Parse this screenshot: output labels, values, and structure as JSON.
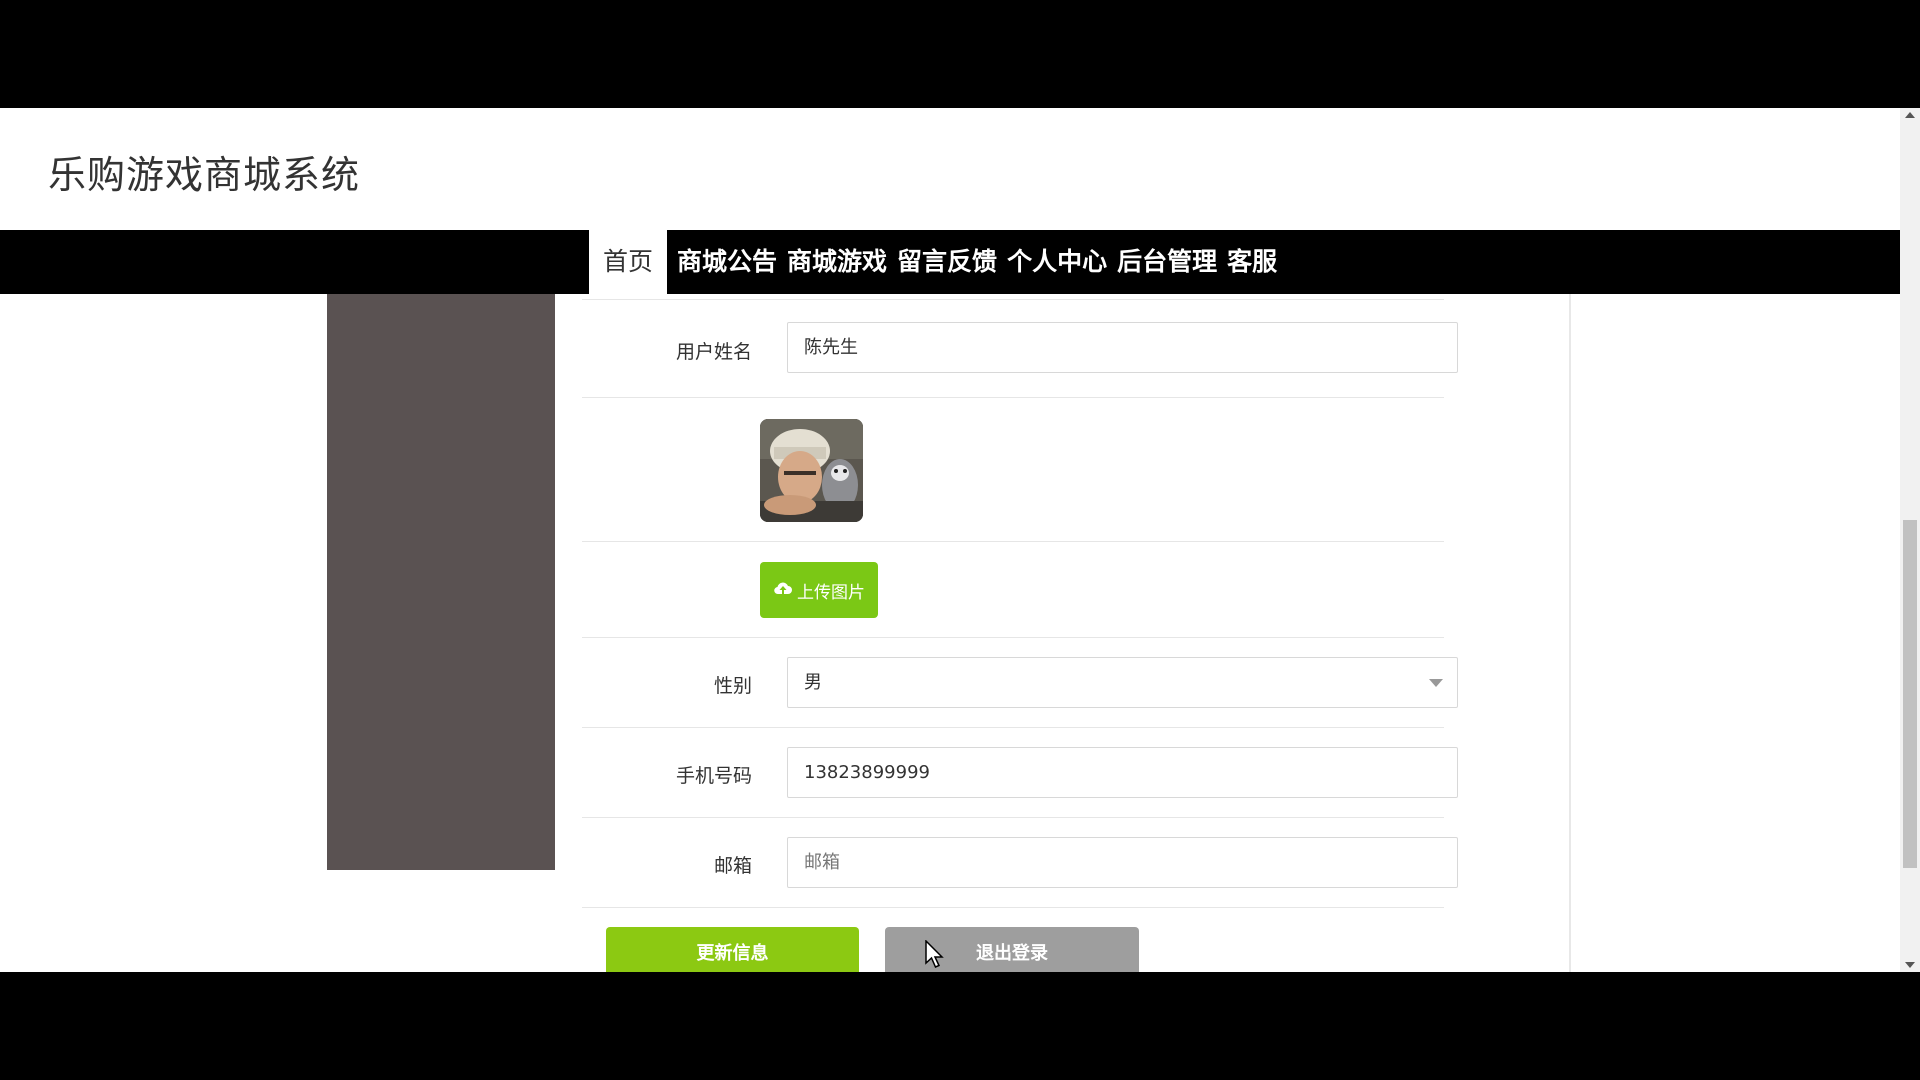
{
  "site": {
    "title": "乐购游戏商城系统"
  },
  "nav": {
    "items": [
      {
        "label": "首页",
        "active": true
      },
      {
        "label": "商城公告"
      },
      {
        "label": "商城游戏"
      },
      {
        "label": "留言反馈"
      },
      {
        "label": "个人中心"
      },
      {
        "label": "后台管理"
      },
      {
        "label": "客服"
      }
    ]
  },
  "form": {
    "name_label": "用户姓名",
    "name_value": "陈先生",
    "upload_label": "上传图片",
    "gender_label": "性别",
    "gender_value": "男",
    "phone_label": "手机号码",
    "phone_value": "13823899999",
    "email_label": "邮箱",
    "email_placeholder": "邮箱",
    "update_label": "更新信息",
    "logout_label": "退出登录"
  },
  "icons": {
    "upload": "cloud-upload-icon",
    "dropdown": "chevron-down-icon",
    "cursor": "mouse-pointer-icon"
  },
  "colors": {
    "nav_bg": "#000000",
    "primary_green": "#8cc912",
    "upload_green": "#7bc815",
    "logout_gray": "#9e9e9e",
    "side_panel": "#5a5252"
  }
}
